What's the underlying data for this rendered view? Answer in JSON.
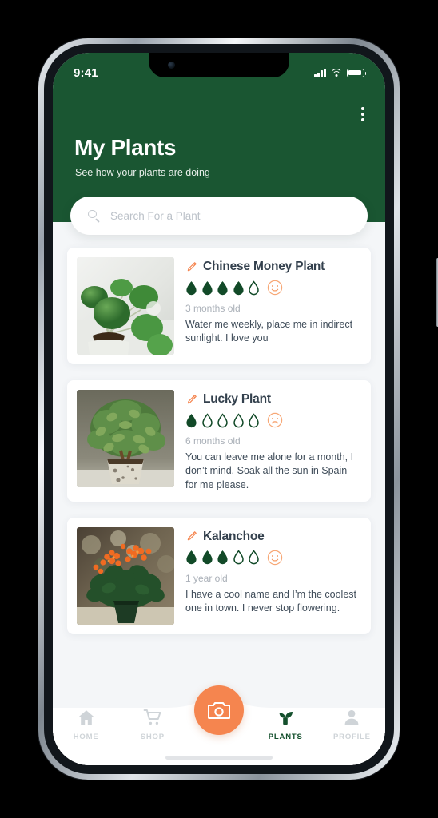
{
  "status_bar": {
    "time": "9:41",
    "icons": [
      "signal-bars-icon",
      "wifi-icon",
      "battery-icon"
    ]
  },
  "header": {
    "title": "My Plants",
    "subtitle": "See how your plants are doing",
    "menu_icon": "kebab-menu-icon",
    "background_color": "#1a5632"
  },
  "search": {
    "placeholder": "Search For a Plant",
    "value": "",
    "icon": "search-icon"
  },
  "plants": [
    {
      "name": "Chinese Money Plant",
      "edit_icon": "pencil-icon",
      "water_filled": 4,
      "water_total": 5,
      "mood": "happy",
      "age": "3 months old",
      "description": "Water me weekly, place me in indirect sunlight. I love you",
      "image": "chinese-money-plant-photo"
    },
    {
      "name": "Lucky Plant",
      "edit_icon": "pencil-icon",
      "water_filled": 1,
      "water_total": 5,
      "mood": "sad",
      "age": "6 months old",
      "description": "You can leave me alone for a month, I don’t mind. Soak all the sun in Spain for me please.",
      "image": "lucky-plant-jade-photo"
    },
    {
      "name": "Kalanchoe",
      "edit_icon": "pencil-icon",
      "water_filled": 3,
      "water_total": 5,
      "mood": "happy",
      "age": "1 year old",
      "description": "I have a cool name and I’m the coolest one in town. I never stop flowering.",
      "image": "kalanchoe-orange-flowers-photo"
    }
  ],
  "bottom_nav": {
    "items": [
      {
        "label": "HOME",
        "icon": "home-icon",
        "active": false
      },
      {
        "label": "SHOP",
        "icon": "cart-icon",
        "active": false
      },
      {
        "label": "PLANTS",
        "icon": "plant-sprout-icon",
        "active": true
      },
      {
        "label": "PROFILE",
        "icon": "person-icon",
        "active": false
      }
    ],
    "fab": {
      "icon": "camera-icon",
      "color": "#f5854f"
    },
    "active_color": "#14502d",
    "inactive_color": "#cfd4d8"
  },
  "colors": {
    "header_green": "#1a5632",
    "drop_green": "#124a28",
    "accent_orange": "#f5854f",
    "page_background": "#f4f6f8",
    "card_background": "#ffffff",
    "title_text": "#33404d",
    "muted_text": "#aab0b8"
  }
}
